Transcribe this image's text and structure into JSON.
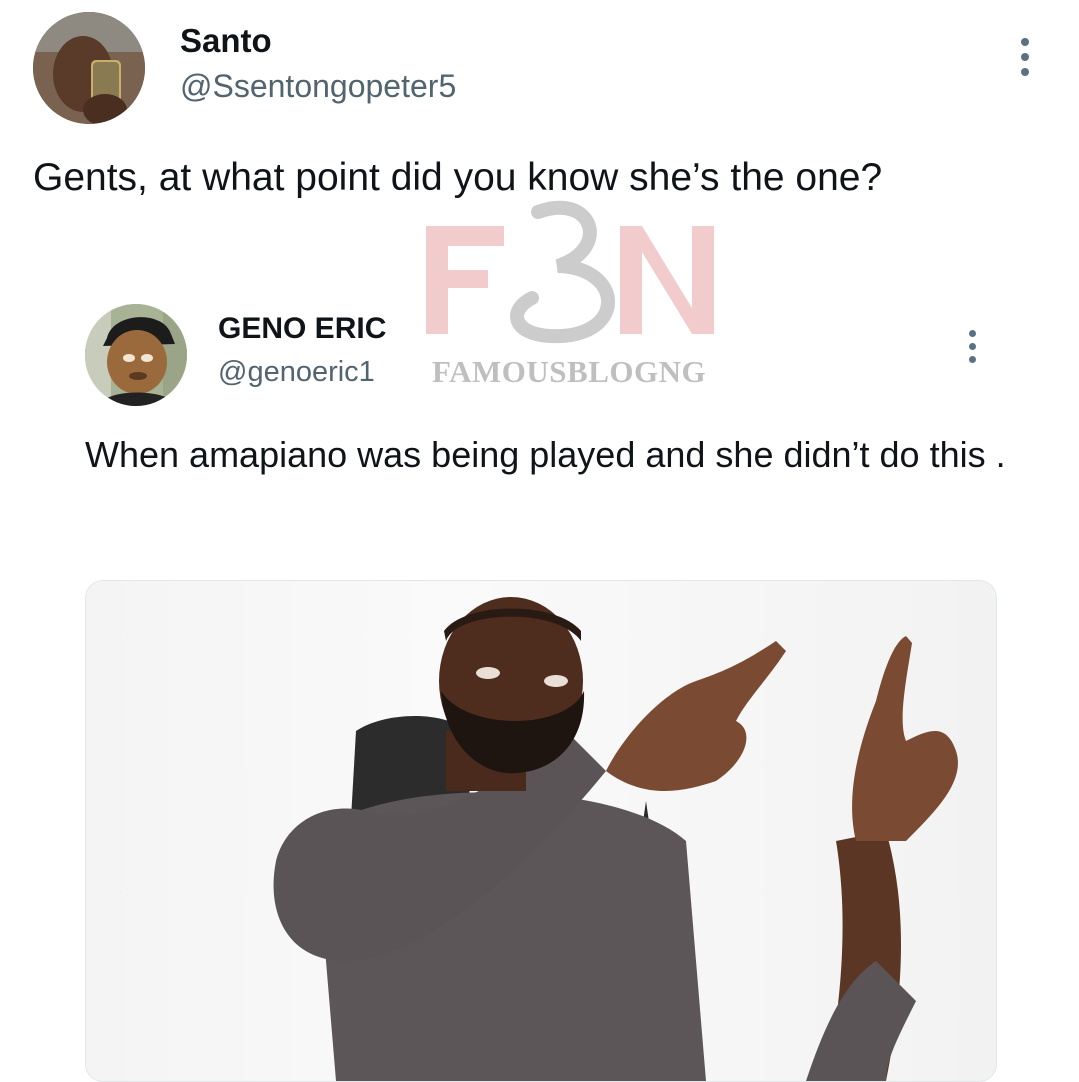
{
  "tweet": {
    "author_name": "Santo",
    "author_handle": "@Ssentongopeter5",
    "text": "Gents, at what point did you know she’s the one?"
  },
  "quote": {
    "author_name": "GENO ERIC",
    "author_handle": "@genoeric1",
    "text": "When amapiano was being played and she didn’t do this ."
  },
  "watermark": {
    "logo": "FBN",
    "text": "FAMOUSBLOGNG"
  },
  "icons": {
    "more": "more-options-icon"
  },
  "colors": {
    "text_primary": "#0f1419",
    "text_secondary": "#536471",
    "watermark_red": "#e07a7a"
  }
}
